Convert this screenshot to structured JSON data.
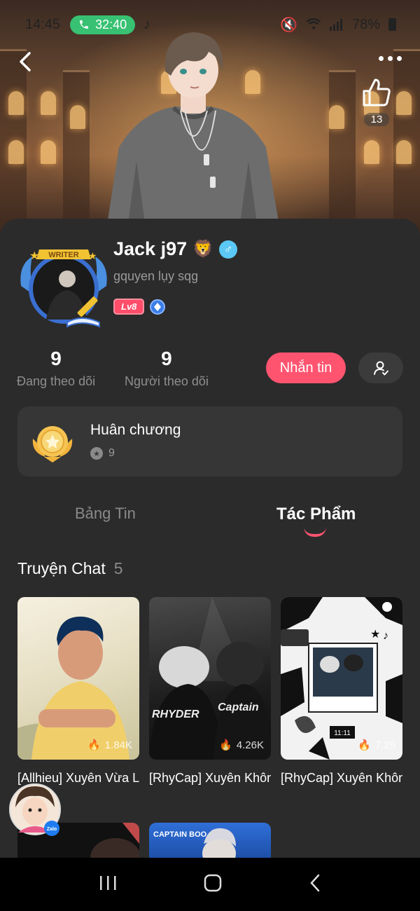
{
  "status_bar": {
    "time": "14:45",
    "call_timer": "32:40",
    "battery": "78%"
  },
  "header": {
    "like_count": "13"
  },
  "profile": {
    "name": "Jack j97",
    "name_emoji": "🦁",
    "bio": "gquyen lụy sqg",
    "level_badge": "Lv8",
    "avatar_frame_label": "WRITER"
  },
  "stats": {
    "following_count": "9",
    "following_label": "Đang theo dõi",
    "followers_count": "9",
    "followers_label": "Người theo dõi"
  },
  "actions": {
    "message_label": "Nhắn tin"
  },
  "medals": {
    "title": "Huân chương",
    "count": "9"
  },
  "tabs": {
    "feed": "Bảng Tin",
    "works": "Tác Phẩm"
  },
  "section": {
    "title": "Truyện Chat",
    "count": "5"
  },
  "stories": [
    {
      "title": "[Allhieu] Xuyên Vừa Làm ...",
      "views": "1.84K"
    },
    {
      "title": "[RhyCap] Xuyên Không Vào Một ...",
      "views": "4.26K"
    },
    {
      "title": "[RhyCap] Xuyên Không, Tôi Nghe ...",
      "views": "7.25"
    }
  ],
  "thumb_texts": {
    "rhyder": "RHYDER",
    "captain": "Captain",
    "captain_boo": "CAPTAIN BOO",
    "clock": "11:11"
  },
  "zalo_label": "Zalo",
  "colors": {
    "accent": "#ff5470",
    "background": "#2b2b2b",
    "panel": "#363636",
    "call_green": "#38c172"
  }
}
